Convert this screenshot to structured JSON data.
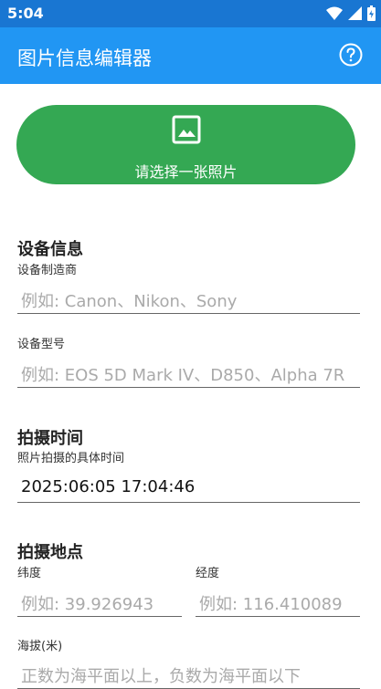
{
  "status": {
    "time": "5:04"
  },
  "appbar": {
    "title": "图片信息编辑器",
    "help_icon": "help-circle-icon"
  },
  "pick_button": {
    "icon": "image-icon",
    "label": "请选择一张照片"
  },
  "device": {
    "title": "设备信息",
    "maker_label": "设备制造商",
    "maker_placeholder": "例如: Canon、Nikon、Sony",
    "model_label": "设备型号",
    "model_placeholder": "例如: EOS 5D Mark IV、D850、Alpha 7R"
  },
  "time": {
    "title": "拍摄时间",
    "label": "照片拍摄的具体时间",
    "value": "2025:06:05 17:04:46"
  },
  "location": {
    "title": "拍摄地点",
    "lat_label": "纬度",
    "lat_placeholder": "例如: 39.926943",
    "lon_label": "经度",
    "lon_placeholder": "例如: 116.410089",
    "alt_label": "海拔(米)",
    "alt_placeholder": "正数为海平面以上，负数为海平面以下"
  },
  "colors": {
    "statusbar": "#1976d2",
    "appbar": "#2196f3",
    "button": "#34a853"
  }
}
